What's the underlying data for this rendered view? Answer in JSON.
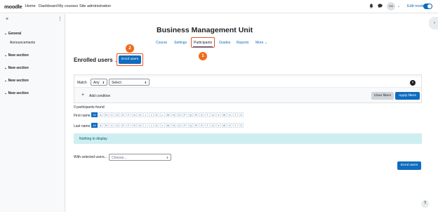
{
  "topnav": {
    "brand": "moodle",
    "links": [
      "Home",
      "Dashboard",
      "My courses",
      "Site administration"
    ],
    "avatar_initials": "AU",
    "edit_mode_label": "Edit mode",
    "edit_mode_on": true
  },
  "drawer": {
    "close_icon": "close-icon",
    "sections": [
      {
        "label": "General",
        "expanded": true,
        "items": [
          "Announcements"
        ]
      },
      {
        "label": "New section",
        "expanded": false
      },
      {
        "label": "New section",
        "expanded": false
      },
      {
        "label": "New section",
        "expanded": false
      },
      {
        "label": "New section",
        "expanded": false
      }
    ]
  },
  "course": {
    "title": "Business Management Unit",
    "nav": [
      "Course",
      "Settings",
      "Participants",
      "Grades",
      "Reports",
      "More"
    ],
    "active_nav": "Participants"
  },
  "annotations": {
    "badge1": "1",
    "badge2": "2",
    "color": "#f06a1d"
  },
  "participants": {
    "heading": "Enrolled users",
    "enrol_button": "Enrol users",
    "filter": {
      "match_label": "Match",
      "match_value": "Any",
      "select_value": "Select",
      "add_condition": "Add condition",
      "clear": "Clear filters",
      "apply": "Apply filters"
    },
    "found_text": "0 participants found",
    "first_name_label": "First name",
    "last_name_label": "Last name",
    "letters": [
      "All",
      "A",
      "B",
      "C",
      "D",
      "E",
      "F",
      "G",
      "H",
      "I",
      "J",
      "K",
      "L",
      "M",
      "N",
      "O",
      "P",
      "Q",
      "R",
      "S",
      "T",
      "U",
      "V",
      "W",
      "X",
      "Y",
      "Z"
    ],
    "empty_message": "Nothing to display",
    "with_selected_label": "With selected users...",
    "with_selected_placeholder": "Choose...",
    "enrol_button_bottom": "Enrol users"
  },
  "colors": {
    "primary": "#0f6cbf",
    "info_bg": "#cfeef1",
    "highlight": "#e8542c"
  }
}
